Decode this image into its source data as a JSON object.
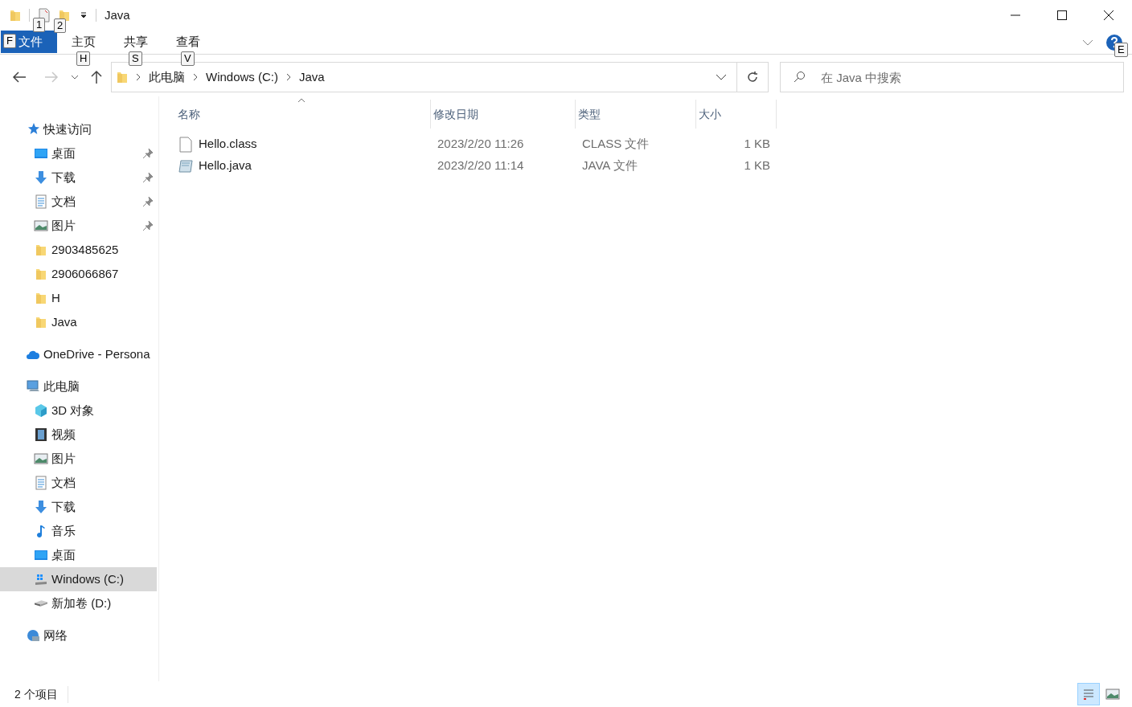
{
  "window": {
    "title": "Java",
    "quick_access_keys": [
      "1",
      "2"
    ]
  },
  "ribbon": {
    "tabs": [
      {
        "label": "文件",
        "key": "F",
        "kind": "file"
      },
      {
        "label": "主页",
        "key": "H",
        "kind": "tab"
      },
      {
        "label": "共享",
        "key": "S",
        "kind": "tab"
      },
      {
        "label": "查看",
        "key": "V",
        "kind": "tab"
      }
    ],
    "help_key": "E"
  },
  "address_bar": {
    "crumbs": [
      "此电脑",
      "Windows (C:)",
      "Java"
    ]
  },
  "search": {
    "placeholder": "在 Java 中搜索"
  },
  "sidebar": {
    "sections": [
      {
        "label": "快速访问",
        "kind": "star",
        "children": [
          {
            "label": "桌面",
            "kind": "desktop",
            "pinned": true,
            "selected": false
          },
          {
            "label": "下载",
            "kind": "download",
            "pinned": true,
            "selected": false
          },
          {
            "label": "文档",
            "kind": "document",
            "pinned": true,
            "selected": false
          },
          {
            "label": "图片",
            "kind": "pictures",
            "pinned": true,
            "selected": false
          },
          {
            "label": "2903485625",
            "kind": "folder",
            "pinned": false,
            "selected": false
          },
          {
            "label": "2906066867",
            "kind": "folder",
            "pinned": false,
            "selected": false
          },
          {
            "label": "H",
            "kind": "folder",
            "pinned": false,
            "selected": false
          },
          {
            "label": "Java",
            "kind": "folder",
            "pinned": false,
            "selected": false
          }
        ]
      },
      {
        "label": "OneDrive - Persona",
        "kind": "cloud"
      },
      {
        "label": "此电脑",
        "kind": "pc",
        "children": [
          {
            "label": "3D 对象",
            "kind": "cube",
            "pinned": false,
            "selected": false
          },
          {
            "label": "视频",
            "kind": "video",
            "pinned": false,
            "selected": false
          },
          {
            "label": "图片",
            "kind": "pictures",
            "pinned": false,
            "selected": false
          },
          {
            "label": "文档",
            "kind": "document",
            "pinned": false,
            "selected": false
          },
          {
            "label": "下载",
            "kind": "download",
            "pinned": false,
            "selected": false
          },
          {
            "label": "音乐",
            "kind": "music",
            "pinned": false,
            "selected": false
          },
          {
            "label": "桌面",
            "kind": "desktop",
            "pinned": false,
            "selected": false
          },
          {
            "label": "Windows (C:)",
            "kind": "windrive",
            "pinned": false,
            "selected": true
          },
          {
            "label": "新加卷 (D:)",
            "kind": "drive",
            "pinned": false,
            "selected": false
          }
        ]
      },
      {
        "label": "网络",
        "kind": "network"
      }
    ]
  },
  "file_list": {
    "columns": [
      "名称",
      "修改日期",
      "类型",
      "大小"
    ],
    "rows": [
      {
        "name": "Hello.class",
        "kind": "blank",
        "modified": "2023/2/20 11:26",
        "type": "CLASS 文件",
        "size": "1 KB"
      },
      {
        "name": "Hello.java",
        "kind": "java",
        "modified": "2023/2/20 11:14",
        "type": "JAVA 文件",
        "size": "1 KB"
      }
    ]
  },
  "status_bar": {
    "count": "2 个项目",
    "view_buttons": [
      {
        "kind": "details",
        "selected": true
      },
      {
        "kind": "thumbnails",
        "selected": false
      }
    ]
  }
}
